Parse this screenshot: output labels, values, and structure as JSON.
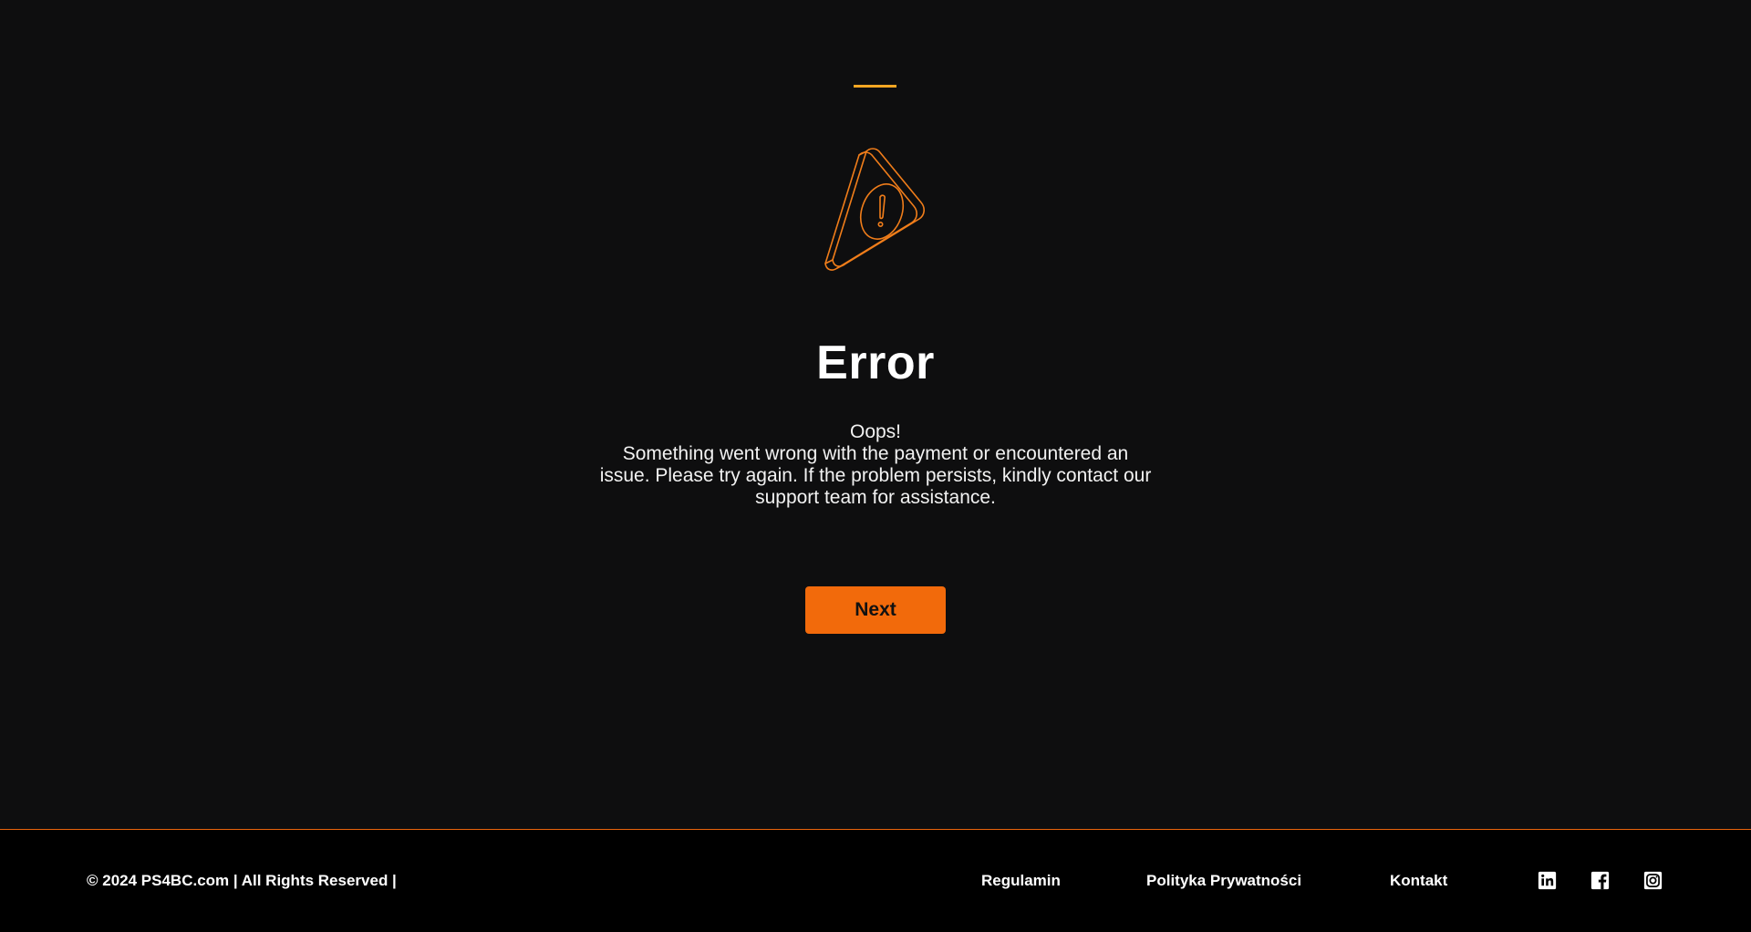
{
  "colors": {
    "background": "#0e0e0f",
    "accent_orange": "#f26a0b",
    "accent_yellow": "#f5a623",
    "footer_background": "#000000",
    "footer_border": "#e8630c"
  },
  "hero": {
    "icon": "warning-triangle-icon",
    "title": "Error",
    "message_lines": [
      "Oops!",
      "Something went wrong with the payment or encountered an",
      "issue. Please try again. If the problem persists, kindly contact our",
      "support team for assistance."
    ],
    "next_label": "Next"
  },
  "footer": {
    "copyright": "© 2024 PS4BC.com | All Rights Reserved |",
    "links": [
      "Regulamin",
      "Polityka Prywatności",
      "Kontakt"
    ],
    "social_icons": [
      "linkedin-icon",
      "facebook-icon",
      "instagram-icon"
    ]
  }
}
